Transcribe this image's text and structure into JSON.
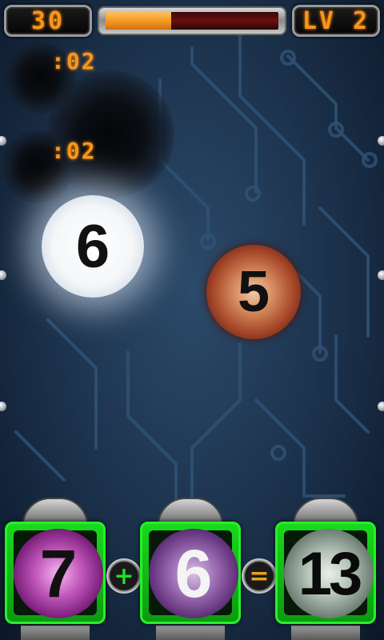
{
  "hud": {
    "score": "30",
    "level": "LV 2",
    "time_remaining_fraction": 0.38
  },
  "timers": [
    {
      "label": ":02"
    },
    {
      "label": ":02"
    }
  ],
  "falling_orbs": [
    {
      "value": "6",
      "style": "white"
    },
    {
      "value": "5",
      "style": "red"
    }
  ],
  "equation": {
    "left": "7",
    "operator": "+",
    "right": "6",
    "equals": "=",
    "result": "13"
  },
  "colors": {
    "hud_text": "#f6961e",
    "time_fill": "#f59a20",
    "pod_green": "#19d91c",
    "background": "#1e3550"
  }
}
